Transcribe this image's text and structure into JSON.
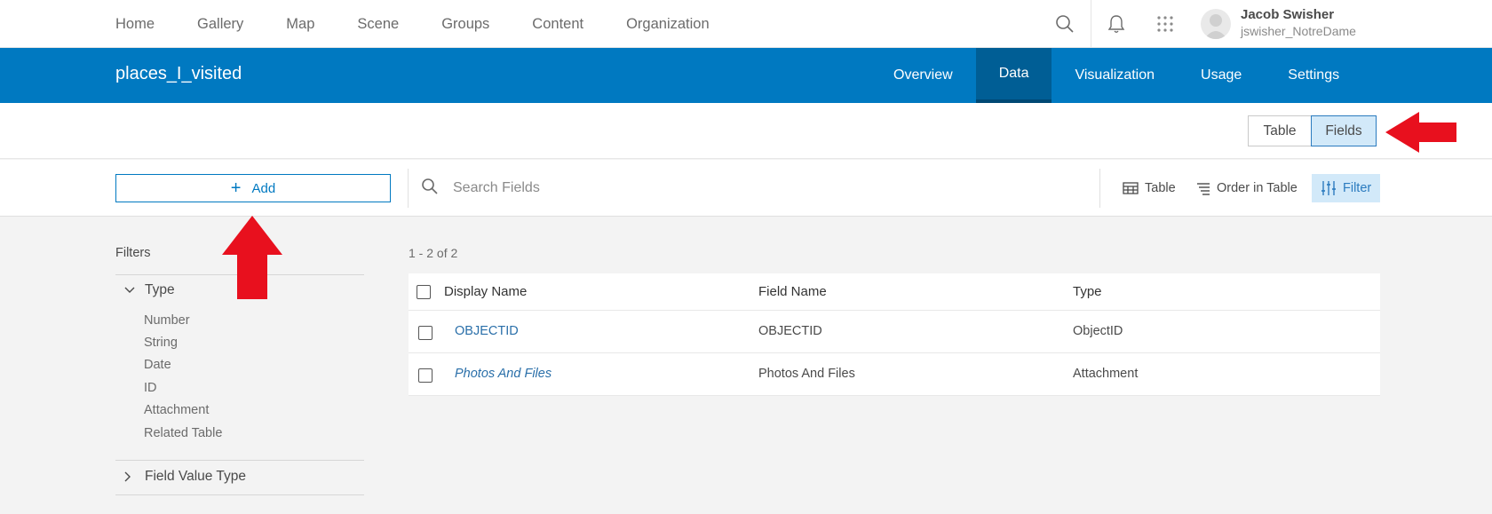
{
  "topnav": {
    "links": [
      "Home",
      "Gallery",
      "Map",
      "Scene",
      "Groups",
      "Content",
      "Organization"
    ],
    "user_name": "Jacob Swisher",
    "user_id": "jswisher_NotreDame",
    "icons": [
      "search-icon",
      "bell-icon",
      "app-launcher-icon"
    ]
  },
  "item": {
    "title": "places_I_visited",
    "tabs": [
      {
        "label": "Overview",
        "active": false
      },
      {
        "label": "Data",
        "active": true
      },
      {
        "label": "Visualization",
        "active": false
      },
      {
        "label": "Usage",
        "active": false
      },
      {
        "label": "Settings",
        "active": false
      }
    ]
  },
  "view_toggle": {
    "table_label": "Table",
    "fields_label": "Fields",
    "selected": "Fields"
  },
  "toolbar": {
    "add_label": "Add",
    "search_placeholder": "Search Fields",
    "table_label": "Table",
    "order_label": "Order in Table",
    "filter_label": "Filter"
  },
  "filters": {
    "heading": "Filters",
    "type_group": "Type",
    "type_options": [
      "Number",
      "String",
      "Date",
      "ID",
      "Attachment",
      "Related Table"
    ],
    "field_value_group": "Field Value Type"
  },
  "fields_table": {
    "count": "1 - 2 of 2",
    "headers": [
      "Display Name",
      "Field Name",
      "Type"
    ],
    "rows": [
      {
        "display_name": "OBJECTID",
        "field_name": "OBJECTID",
        "type": "ObjectID"
      },
      {
        "display_name": "Photos And Files",
        "field_name": "Photos And Files",
        "type": "Attachment"
      }
    ]
  },
  "colors": {
    "brand": "#0079c1",
    "annotation_arrow": "#e8101e"
  }
}
